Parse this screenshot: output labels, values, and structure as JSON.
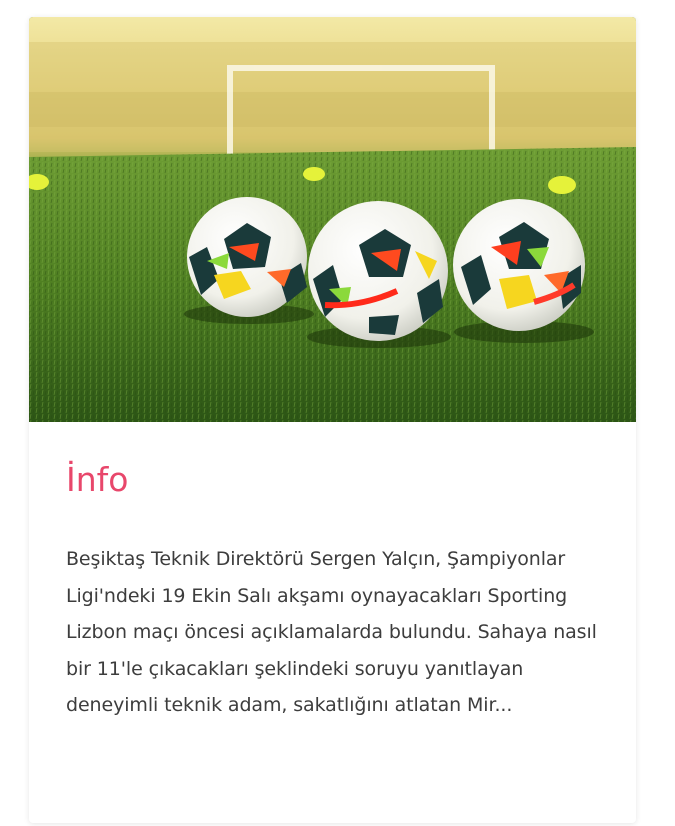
{
  "card": {
    "image_alt": "soccer balls on grass field",
    "title": "İnfo",
    "excerpt": "Beşiktaş Teknik Direktörü Sergen Yalçın, Şampiyonlar Ligi'ndeki 19 Ekin Salı akşamı oynayacakları Sporting Lizbon maçı öncesi açıklamalarda bulundu. Sahaya nasıl bir 11'le çıkacakları şeklindeki soruyu yanıtlayan deneyimli teknik adam, sakatlığını atlatan Mir..."
  },
  "colors": {
    "title": "#e8476b",
    "text": "#3d3d3d",
    "grass": "#4f7a25",
    "sky": "#e9d98a"
  }
}
